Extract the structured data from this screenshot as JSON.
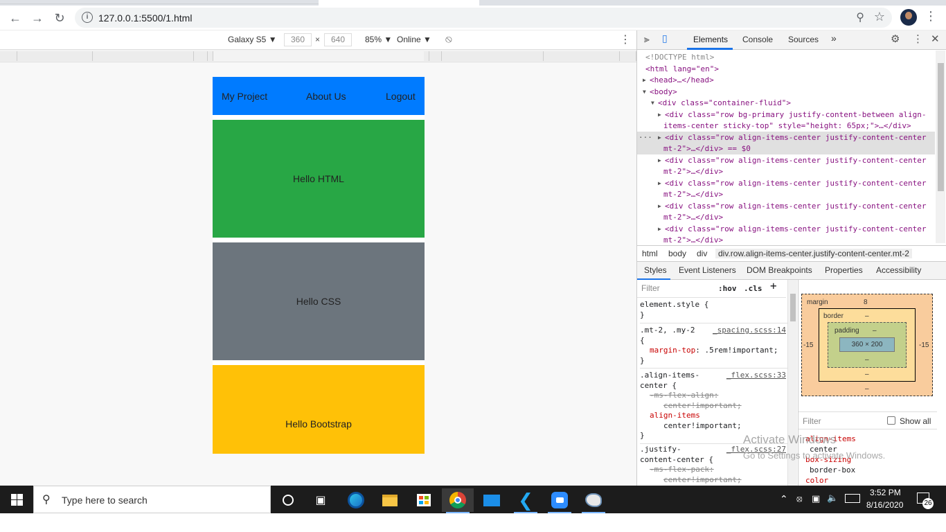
{
  "browser": {
    "url": "127.0.0.1:5500/1.html"
  },
  "device_toolbar": {
    "device": "Galaxy S5 ▼",
    "width": "360",
    "height": "640",
    "zoom": "85% ▼",
    "throttle": "Online ▼"
  },
  "page": {
    "nav": {
      "brand": "My Project",
      "about": "About Us",
      "logout": "Logout"
    },
    "cards": [
      {
        "text": "Hello HTML",
        "color": "#28a745"
      },
      {
        "text": "Hello CSS",
        "color": "#6c757d"
      },
      {
        "text": "Hello Bootstrap",
        "color": "#ffc107"
      }
    ]
  },
  "devtools": {
    "tabs": [
      "Elements",
      "Console",
      "Sources",
      "»"
    ],
    "dom_lines": [
      {
        "t": "<!DOCTYPE html>",
        "cls": "cm"
      },
      {
        "t": "<html lang=\"en\">"
      },
      {
        "t": "<head>…</head>"
      },
      {
        "t": "<body>"
      },
      {
        "t": "<div class=\"container-fluid\">"
      },
      {
        "t": "<div class=\"row bg-primary justify-content-between align-"
      },
      {
        "t": "items-center sticky-top\" style=\"height: 65px;\">…</div>"
      },
      {
        "t": "<div class=\"row align-items-center justify-content-center"
      },
      {
        "t": "mt-2\">…</div> == $0"
      },
      {
        "t": "<div class=\"row align-items-center justify-content-center"
      },
      {
        "t": "mt-2\">…</div>"
      },
      {
        "t": "<div class=\"row align-items-center justify-content-center"
      },
      {
        "t": "mt-2\">…</div>"
      },
      {
        "t": "<div class=\"row align-items-center justify-content-center"
      },
      {
        "t": "mt-2\">…</div>"
      },
      {
        "t": "<div class=\"row align-items-center justify-content-center"
      },
      {
        "t": "mt-2\">…</div>"
      }
    ],
    "breadcrumbs": [
      "html",
      "body",
      "div",
      "div.row.align-items-center.justify-content-center.mt-2"
    ],
    "subtabs": [
      "Styles",
      "Event Listeners",
      "DOM Breakpoints",
      "Properties",
      "Accessibility"
    ],
    "styles_filter": "Filter",
    "hov": ":hov",
    "cls": ".cls",
    "rules": {
      "element_style": "element.style {",
      "close": "}",
      "mt2_selector": ".mt-2, .my-2",
      "mt2_src": "_spacing.scss:14",
      "open": "{",
      "mt2_prop": "margin-top",
      "mt2_val": ": .5rem!important;",
      "ai_selector": ".align-items-",
      "ai_selector2": "center {",
      "ai_src": "_flex.scss:33",
      "ai_ms": "-ms-flex-align:",
      "ai_ms_val": "center!important;",
      "ai_prop": "align-items",
      "ai_val": "center!important;",
      "jc_selector": ".justify-",
      "jc_selector2": "content-center {",
      "jc_src": "_flex.scss:27",
      "jc_ms": "-ms-flex-pack:",
      "jc_ms_val": "center!important;"
    },
    "boxmodel": {
      "margin_label": "margin",
      "margin_top": "8",
      "margin_left": "-15",
      "margin_right": "-15",
      "margin_bottom": "–",
      "border_label": "border",
      "border_val": "–",
      "padding_label": "padding",
      "padding_val": "–",
      "content": "360 × 200"
    },
    "computed_filter": "Filter",
    "show_all": "Show all",
    "computed": [
      {
        "prop": "align-items",
        "val": "center"
      },
      {
        "prop": "box-sizing",
        "val": "border-box"
      },
      {
        "prop": "color",
        "val": ""
      }
    ]
  },
  "watermark": {
    "line1": "Activate Windows",
    "line2": "Go to Settings to activate Windows."
  },
  "taskbar": {
    "search_placeholder": "Type here to search",
    "time": "3:52 PM",
    "date": "8/16/2020",
    "notification_count": "26"
  }
}
